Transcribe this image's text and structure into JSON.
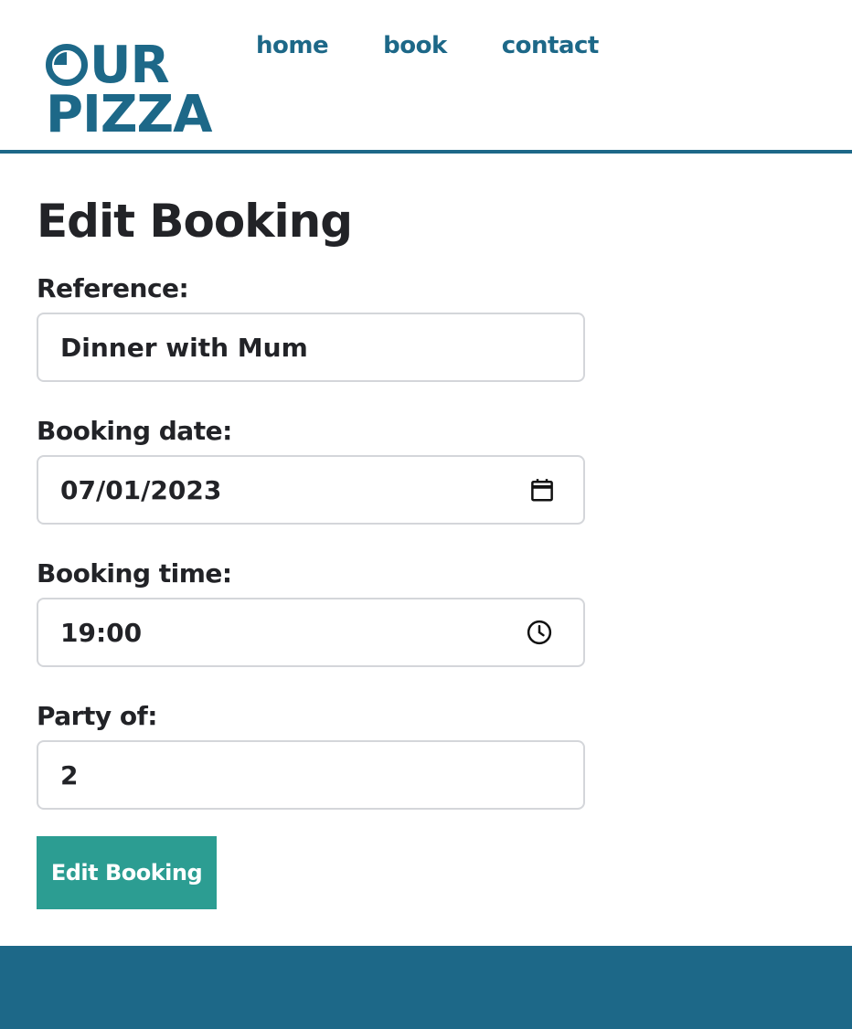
{
  "brand": {
    "logo_line1_rest": "UR",
    "logo_line2": "PIZZA",
    "logo_text": "OUR PIZZA",
    "color": "#1d6888"
  },
  "nav": {
    "items": [
      {
        "label": "home"
      },
      {
        "label": "book"
      },
      {
        "label": "contact"
      }
    ]
  },
  "page": {
    "title": "Edit Booking"
  },
  "form": {
    "reference": {
      "label": "Reference:",
      "value": "Dinner with Mum"
    },
    "booking_date": {
      "label": "Booking date:",
      "value": "07/01/2023",
      "icon": "calendar-icon"
    },
    "booking_time": {
      "label": "Booking time:",
      "value": "19:00",
      "icon": "clock-icon"
    },
    "party_of": {
      "label": "Party of:",
      "value": "2"
    },
    "submit_label": "Edit Booking"
  },
  "colors": {
    "accent": "#1d6888",
    "button": "#2c9d92",
    "text": "#222327",
    "input_border": "#d4d6da"
  }
}
